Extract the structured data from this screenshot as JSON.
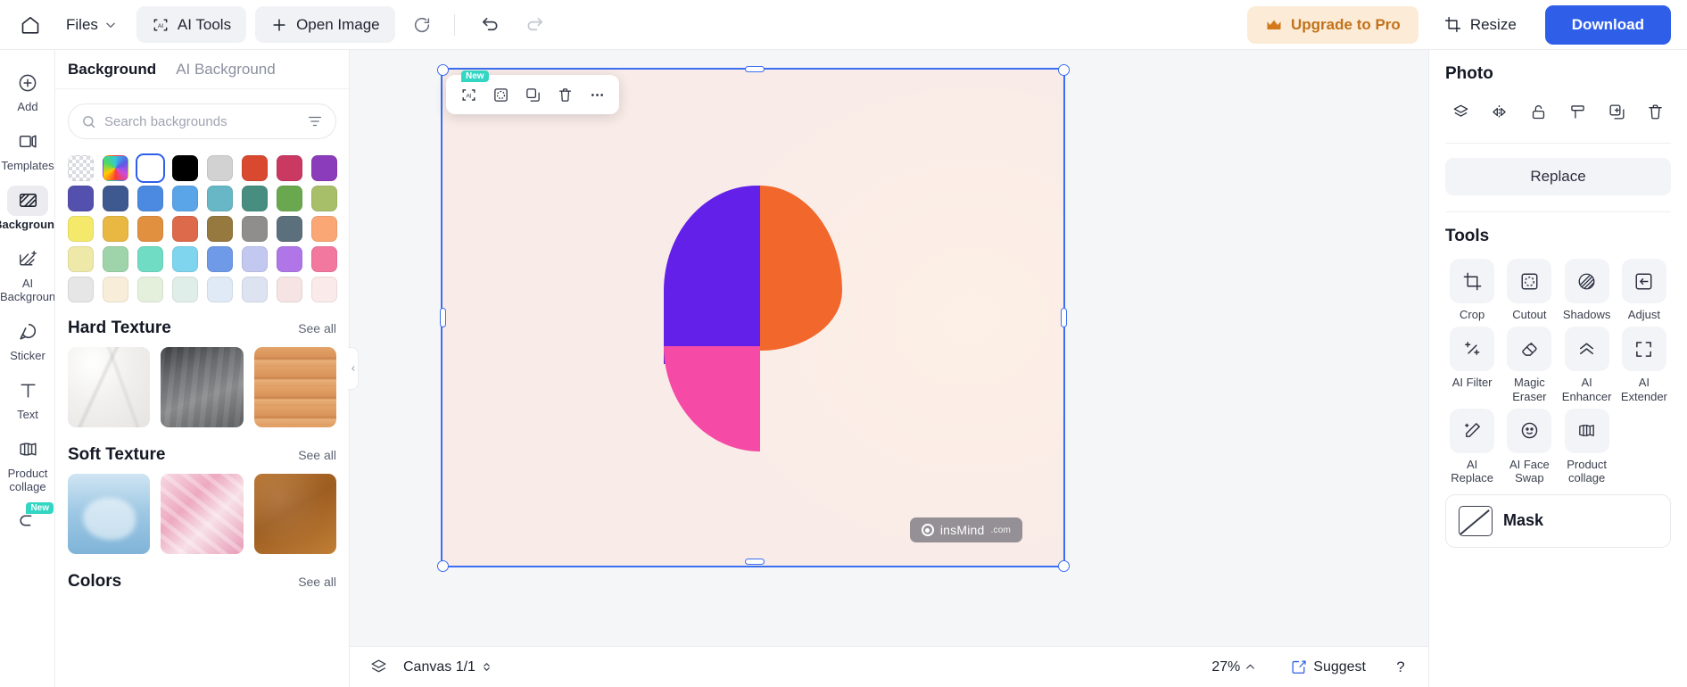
{
  "topbar": {
    "home_icon": "home-icon",
    "files_label": "Files",
    "files_caret": "chevron-down-icon",
    "ai_tools_label": "AI Tools",
    "open_image_label": "Open Image",
    "refresh_icon": "refresh-icon",
    "undo_icon": "undo-icon",
    "redo_icon": "redo-icon",
    "upgrade_label": "Upgrade to Pro",
    "upgrade_icon": "crown-icon",
    "upgrade_bg": "#fcecd7",
    "upgrade_fg": "#c2711a",
    "resize_label": "Resize",
    "resize_icon": "resize-icon",
    "download_label": "Download",
    "download_bg": "#2f5fe8"
  },
  "rail": {
    "items": [
      {
        "label": "Add",
        "icon": "plus-circle-icon",
        "active": false,
        "badge": ""
      },
      {
        "label": "Templates",
        "icon": "templates-icon",
        "active": false,
        "badge": ""
      },
      {
        "label": "Background",
        "icon": "hatch-square-icon",
        "active": true,
        "badge": ""
      },
      {
        "label": "AI Background",
        "icon": "hatch-sparkle-icon",
        "active": false,
        "badge": ""
      },
      {
        "label": "Sticker",
        "icon": "sticker-icon",
        "active": false,
        "badge": ""
      },
      {
        "label": "Text",
        "icon": "text-t-icon",
        "active": false,
        "badge": ""
      },
      {
        "label": "Product collage",
        "icon": "collage-icon",
        "active": false,
        "badge": ""
      },
      {
        "label": "",
        "icon": "effects-icon",
        "active": false,
        "badge": "New"
      }
    ]
  },
  "panel": {
    "tabs": [
      {
        "label": "Background",
        "active": true
      },
      {
        "label": "AI Background",
        "active": false
      }
    ],
    "search": {
      "placeholder": "Search backgrounds",
      "value": "",
      "icon": "search-icon",
      "filter_icon": "filter-icon"
    },
    "swatches": [
      {
        "name": "transparent",
        "color": "transparent",
        "selected": false
      },
      {
        "name": "rainbow",
        "color": "rainbow",
        "selected": false
      },
      {
        "name": "white",
        "color": "#ffffff",
        "selected": true
      },
      {
        "name": "black",
        "color": "#000000",
        "selected": false
      },
      {
        "name": "light-gray",
        "color": "#d2d2d2",
        "selected": false
      },
      {
        "name": "red",
        "color": "#d9492f",
        "selected": false
      },
      {
        "name": "crimson",
        "color": "#c93962",
        "selected": false
      },
      {
        "name": "purple",
        "color": "#8b3cbb",
        "selected": false
      },
      {
        "name": "indigo",
        "color": "#5350ae",
        "selected": false
      },
      {
        "name": "navy",
        "color": "#3e5890",
        "selected": false
      },
      {
        "name": "blue",
        "color": "#4b8ae0",
        "selected": false
      },
      {
        "name": "sky",
        "color": "#5aa5e8",
        "selected": false
      },
      {
        "name": "teal-light",
        "color": "#68b7c6",
        "selected": false
      },
      {
        "name": "teal-dark",
        "color": "#478e80",
        "selected": false
      },
      {
        "name": "green",
        "color": "#6aa84f",
        "selected": false
      },
      {
        "name": "olive",
        "color": "#a7bf68",
        "selected": false
      },
      {
        "name": "yellow",
        "color": "#f4e96b",
        "selected": false
      },
      {
        "name": "amber",
        "color": "#e8b843",
        "selected": false
      },
      {
        "name": "orange",
        "color": "#e1903f",
        "selected": false
      },
      {
        "name": "coral",
        "color": "#dd6a4b",
        "selected": false
      },
      {
        "name": "brown",
        "color": "#96793f",
        "selected": false
      },
      {
        "name": "gray",
        "color": "#8f8e8c",
        "selected": false
      },
      {
        "name": "slate",
        "color": "#5c6f7c",
        "selected": false
      },
      {
        "name": "peach",
        "color": "#fba775",
        "selected": false
      },
      {
        "name": "lemon-fade",
        "color": "#eee9a8",
        "selected": false
      },
      {
        "name": "mint-fade",
        "color": "#9fd4ab",
        "selected": false
      },
      {
        "name": "aqua-fade",
        "color": "#6fdcc3",
        "selected": false
      },
      {
        "name": "cyan-fade",
        "color": "#7fd4ee",
        "selected": false
      },
      {
        "name": "periwinkle",
        "color": "#6e9ae8",
        "selected": false
      },
      {
        "name": "lavender",
        "color": "#c2c8f0",
        "selected": false
      },
      {
        "name": "violet",
        "color": "#b076e8",
        "selected": false
      },
      {
        "name": "pink",
        "color": "#f2789f",
        "selected": false
      },
      {
        "name": "pale-gray",
        "color": "#e6e6e6",
        "selected": false
      },
      {
        "name": "cream",
        "color": "#f8edd9",
        "selected": false
      },
      {
        "name": "pale-green",
        "color": "#e4f0dc",
        "selected": false
      },
      {
        "name": "pale-mint",
        "color": "#dfeee8",
        "selected": false
      },
      {
        "name": "pale-blue",
        "color": "#dfeaf6",
        "selected": false
      },
      {
        "name": "pale-lilac",
        "color": "#dee3f2",
        "selected": false
      },
      {
        "name": "pale-rose",
        "color": "#f6e3e3",
        "selected": false
      },
      {
        "name": "blush",
        "color": "#fbeaea",
        "selected": false
      }
    ],
    "sections": [
      {
        "title": "Hard Texture",
        "see_all": "See all",
        "thumbs": [
          {
            "name": "marble-texture",
            "style": "th-marble"
          },
          {
            "name": "concrete-texture",
            "style": "th-concrete"
          },
          {
            "name": "wood-texture",
            "style": "th-wood"
          }
        ]
      },
      {
        "title": "Soft Texture",
        "see_all": "See all",
        "thumbs": [
          {
            "name": "water-texture",
            "style": "th-water"
          },
          {
            "name": "silk-texture",
            "style": "th-silk"
          },
          {
            "name": "leather-texture",
            "style": "th-leather"
          }
        ]
      },
      {
        "title": "Colors",
        "see_all": "See all",
        "thumbs": []
      }
    ],
    "collapse_icon": "chevron-left-icon"
  },
  "canvas": {
    "float_toolbar": [
      {
        "name": "ai-select-button",
        "icon": "ai-bracket-icon",
        "badge": "New"
      },
      {
        "name": "cutout-button",
        "icon": "cutout-icon",
        "badge": ""
      },
      {
        "name": "duplicate-button",
        "icon": "duplicate-icon",
        "badge": ""
      },
      {
        "name": "delete-button",
        "icon": "trash-icon",
        "badge": ""
      },
      {
        "name": "more-button",
        "icon": "ellipsis-icon",
        "badge": ""
      }
    ],
    "artboard_bg": "#f9ebe7",
    "selection_color": "#3b6ef0",
    "logo_colors": {
      "purple": "#6320e8",
      "orange": "#f2672c",
      "pink": "#f54ba6"
    },
    "watermark": {
      "text": "insMind",
      "suffix": ".com",
      "icon": "insmind-logo-icon"
    }
  },
  "bottombar": {
    "layers_icon": "layers-icon",
    "canvas_label": "Canvas 1/1",
    "canvas_caret": "chevron-updown-icon",
    "zoom_label": "27%",
    "zoom_caret": "chevron-up-icon",
    "suggest_label": "Suggest",
    "suggest_icon": "suggest-icon",
    "help_label": "?"
  },
  "right": {
    "title": "Photo",
    "actions": [
      {
        "name": "layer-order-icon",
        "label": "Layer"
      },
      {
        "name": "flip-icon",
        "label": "Flip"
      },
      {
        "name": "unlock-icon",
        "label": "Lock"
      },
      {
        "name": "format-paint-icon",
        "label": "Format"
      },
      {
        "name": "duplicate-icon",
        "label": "Duplicate"
      },
      {
        "name": "trash-icon",
        "label": "Delete"
      }
    ],
    "replace_label": "Replace",
    "tools_title": "Tools",
    "tools": [
      {
        "label": "Crop",
        "icon": "crop-icon"
      },
      {
        "label": "Cutout",
        "icon": "cutout-icon"
      },
      {
        "label": "Shadows",
        "icon": "shadows-icon"
      },
      {
        "label": "Adjust",
        "icon": "adjust-icon"
      },
      {
        "label": "AI Filter",
        "icon": "ai-filter-icon"
      },
      {
        "label": "Magic Eraser",
        "icon": "eraser-icon"
      },
      {
        "label": "AI Enhancer",
        "icon": "enhancer-icon"
      },
      {
        "label": "AI Extender",
        "icon": "extender-icon"
      },
      {
        "label": "AI Replace",
        "icon": "ai-replace-icon"
      },
      {
        "label": "AI Face Swap",
        "icon": "face-swap-icon"
      },
      {
        "label": "Product collage",
        "icon": "collage-icon"
      },
      {
        "label": "",
        "icon": ""
      }
    ],
    "mask_label": "Mask",
    "mask_icon": "mask-icon"
  }
}
